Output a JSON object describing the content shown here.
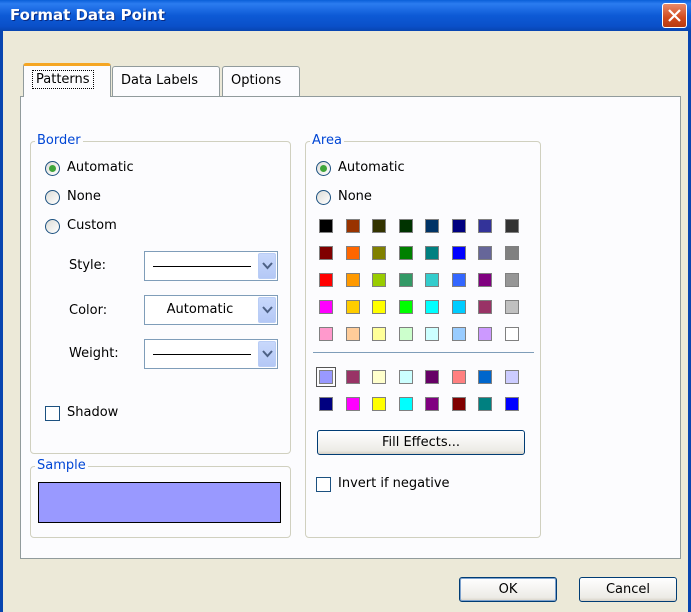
{
  "window": {
    "title": "Format Data Point"
  },
  "tabs": [
    {
      "label": "Patterns",
      "active": true
    },
    {
      "label": "Data Labels",
      "active": false
    },
    {
      "label": "Options",
      "active": false
    }
  ],
  "border": {
    "title": "Border",
    "options": [
      {
        "label": "Automatic",
        "selected": true
      },
      {
        "label": "None",
        "selected": false
      },
      {
        "label": "Custom",
        "selected": false
      }
    ],
    "style_label": "Style:",
    "color_label": "Color:",
    "color_value": "Automatic",
    "weight_label": "Weight:",
    "shadow_label": "Shadow",
    "shadow_checked": false
  },
  "sample": {
    "title": "Sample",
    "color": "#9999ff"
  },
  "area": {
    "title": "Area",
    "options": [
      {
        "label": "Automatic",
        "selected": true
      },
      {
        "label": "None",
        "selected": false
      }
    ],
    "palette": [
      [
        "#000000",
        "#993300",
        "#333300",
        "#003300",
        "#003366",
        "#000080",
        "#333399",
        "#333333"
      ],
      [
        "#800000",
        "#ff6600",
        "#808000",
        "#008000",
        "#008080",
        "#0000ff",
        "#666699",
        "#808080"
      ],
      [
        "#ff0000",
        "#ff9900",
        "#99cc00",
        "#339966",
        "#33cccc",
        "#3366ff",
        "#800080",
        "#969696"
      ],
      [
        "#ff00ff",
        "#ffcc00",
        "#ffff00",
        "#00ff00",
        "#00ffff",
        "#00ccff",
        "#993366",
        "#c0c0c0"
      ],
      [
        "#ff99cc",
        "#ffcc99",
        "#ffff99",
        "#ccffcc",
        "#ccffff",
        "#99ccff",
        "#cc99ff",
        "#ffffff"
      ]
    ],
    "chart_palette": [
      [
        "#9999ff",
        "#993366",
        "#ffffcc",
        "#ccffff",
        "#660066",
        "#ff8080",
        "#0066cc",
        "#ccccff"
      ],
      [
        "#000080",
        "#ff00ff",
        "#ffff00",
        "#00ffff",
        "#800080",
        "#800000",
        "#008080",
        "#0000ff"
      ]
    ],
    "selected_swatch": "#9999ff",
    "fill_effects_label": "Fill Effects...",
    "invert_label": "Invert if negative",
    "invert_checked": false
  },
  "buttons": {
    "ok": "OK",
    "cancel": "Cancel"
  }
}
